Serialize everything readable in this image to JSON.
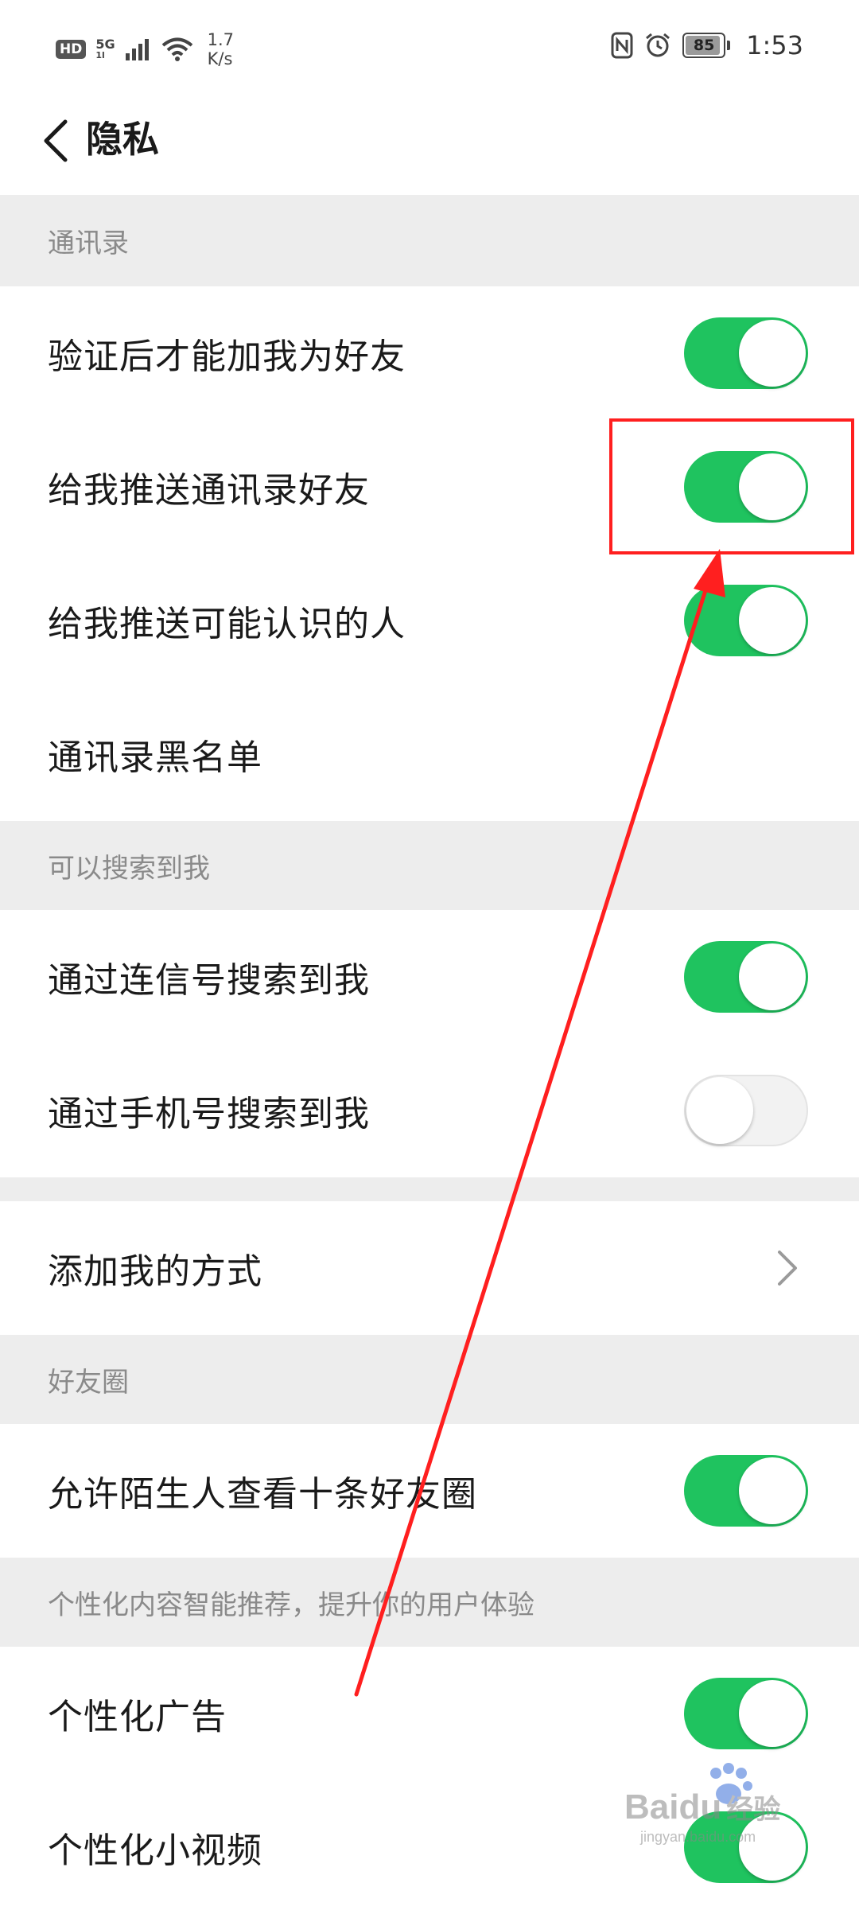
{
  "status_bar": {
    "hd": "HD",
    "network": "5G",
    "network_sub": "1l",
    "speed_value": "1.7",
    "speed_unit": "K/s",
    "battery": "85",
    "time": "1:53"
  },
  "nav": {
    "title": "隐私"
  },
  "sections": {
    "contacts": {
      "header": "通讯录",
      "rows": [
        {
          "label": "验证后才能加我为好友",
          "toggle": true
        },
        {
          "label": "给我推送通讯录好友",
          "toggle": true
        },
        {
          "label": "给我推送可能认识的人",
          "toggle": true
        },
        {
          "label": "通讯录黑名单"
        }
      ]
    },
    "search": {
      "header": "可以搜索到我",
      "rows": [
        {
          "label": "通过连信号搜索到我",
          "toggle": true
        },
        {
          "label": "通过手机号搜索到我",
          "toggle": false
        }
      ]
    },
    "add": {
      "rows": [
        {
          "label": "添加我的方式"
        }
      ]
    },
    "moments": {
      "header": "好友圈",
      "rows": [
        {
          "label": "允许陌生人查看十条好友圈",
          "toggle": true
        }
      ]
    },
    "personalize": {
      "header": "个性化内容智能推荐，提升你的用户体验",
      "rows": [
        {
          "label": "个性化广告",
          "toggle": true
        },
        {
          "label": "个性化小视频",
          "toggle": true
        }
      ]
    }
  },
  "colors": {
    "toggle_on": "#1fc35f",
    "annotation": "#ff1f1f",
    "section_bg": "#ededed"
  },
  "watermark": {
    "brand": "Bai",
    "brand_suffix": "du",
    "product": "经验",
    "url": "jingyan.baidu.com"
  }
}
